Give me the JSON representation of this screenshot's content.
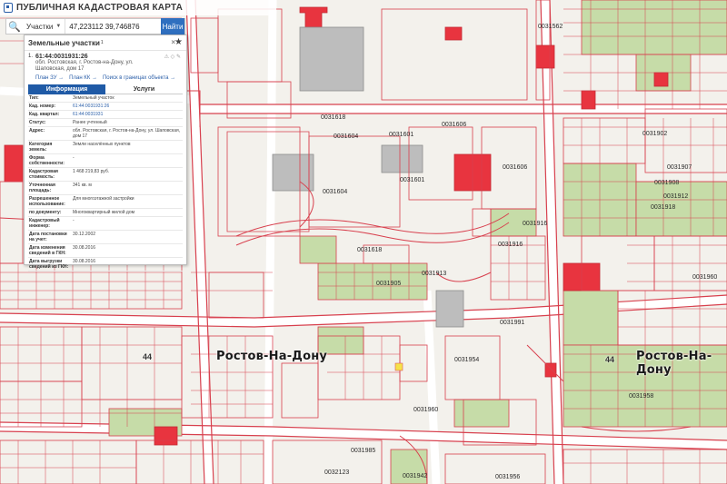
{
  "app": {
    "title": "ПУБЛИЧНАЯ КАДАСТРОВАЯ КАРТА"
  },
  "search": {
    "type_label": "Участки",
    "query": "47,223112 39,746876",
    "button_label": "Найти"
  },
  "panel": {
    "title": "Земельные участки",
    "count": "1",
    "item_number": "1.",
    "cadastral_number": "61:44:0031931:26",
    "address_line1": "обл. Ростовская, г. Ростов-на-Дону, ул.",
    "address_line2": "Шаповская, дом 17",
    "links": [
      "План ЗУ →",
      "План КК →",
      "Поиск в границах объекта →"
    ],
    "tabs": [
      "Информация",
      "Услуги"
    ],
    "props": [
      {
        "k": "Тип:",
        "v": "Земельный участок"
      },
      {
        "k": "Кад. номер:",
        "v": "61:44:0031931:26",
        "link": true
      },
      {
        "k": "Кад. квартал:",
        "v": "61:44:0031931",
        "link": true
      },
      {
        "k": "Статус:",
        "v": "Ранее учтенный"
      },
      {
        "k": "Адрес:",
        "v": "обл. Ростовская, г. Ростов-на-Дону, ул. Шаповская, дом 17"
      },
      {
        "k": "Категория земель:",
        "v": "Земли населённых пунктов"
      },
      {
        "k": "Форма собственности:",
        "v": "-"
      },
      {
        "k": "Кадастровая стоимость:",
        "v": "1 468 219,83 руб."
      },
      {
        "k": "Уточненная площадь:",
        "v": "341 кв. м"
      },
      {
        "k": "Разрешенное использование:",
        "v": "Для многоэтажной застройки"
      },
      {
        "k": "по документу:",
        "v": "Многоквартирный жилой дом"
      },
      {
        "k": "Кадастровый инженер:",
        "v": "-"
      },
      {
        "k": "Дата постановки на учет:",
        "v": "30.12.2002"
      },
      {
        "k": "Дата изменения сведений в ГКН:",
        "v": "30.08.2016"
      },
      {
        "k": "Дата выгрузки сведений из ГКН:",
        "v": "30.08.2016"
      }
    ]
  },
  "map": {
    "city_labels": [
      "Ростов-На-Дону",
      "Ростов-На-Дону"
    ],
    "street_labels": [
      "44",
      "44"
    ],
    "block_labels": [
      "0031618",
      "0031604",
      "0031601",
      "0031606",
      "0031604",
      "0031601",
      "0031606",
      "0031618",
      "0031913",
      "0031916",
      "0031916",
      "0031991",
      "0031905",
      "0031954",
      "0031942",
      "0031956",
      "0032123",
      "0031985",
      "0031960",
      "0031562",
      "0031902",
      "0031907",
      "0031908",
      "0031912",
      "0031918",
      "0031960",
      "0031958"
    ],
    "colors": {
      "boundary": "#d8404e",
      "fill_red": "#e8343f",
      "green": "#c6dca8",
      "road": "#ffffff"
    }
  }
}
